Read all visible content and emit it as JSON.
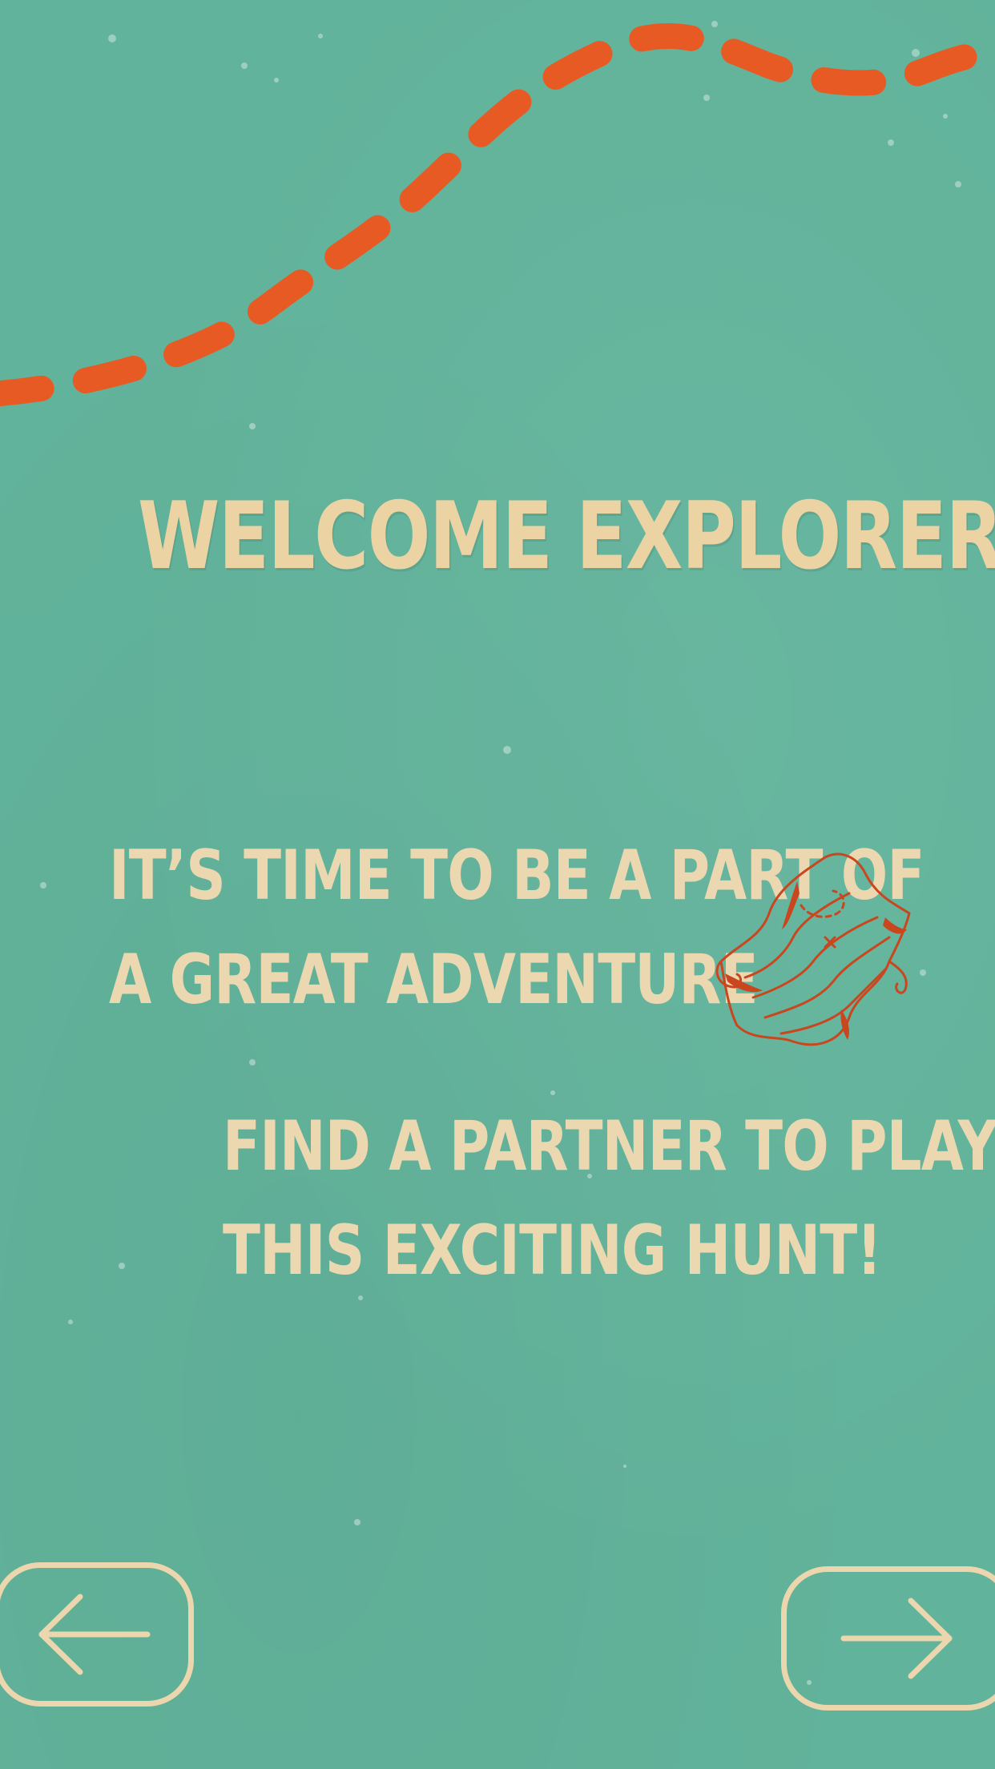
{
  "screen": {
    "background_color": "#62b39b",
    "trail_color": "#e85a24",
    "text_color": "#ebd6ad"
  },
  "welcome": {
    "title": "WELCOME EXPLORER!"
  },
  "intro": {
    "line1": "IT’S TIME TO BE A PART OF",
    "line2": "A GREAT ADVENTURE"
  },
  "instruction": {
    "line1": "FIND A PARTNER TO PLAY",
    "line2": "THIS EXCITING HUNT!"
  },
  "icons": {
    "map": "treasure-map-icon",
    "back": "arrow-left-icon",
    "next": "arrow-right-icon"
  }
}
